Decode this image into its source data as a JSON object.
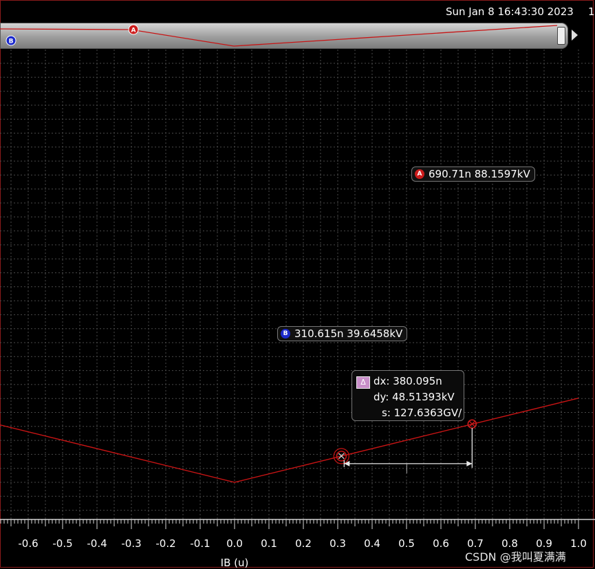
{
  "header": {
    "datetime": "Sun Jan 8 16:43:30 2023",
    "edge_char": "1"
  },
  "overview": {
    "marker_a_label": "A",
    "marker_b_label": "B"
  },
  "chart_data": {
    "type": "line",
    "xlabel": "IB (u)",
    "x_tick_labels": [
      "-0.6",
      "-0.5",
      "-0.4",
      "-0.3",
      "-0.2",
      "-0.1",
      "0.0",
      "0.1",
      "0.2",
      "0.3",
      "0.4",
      "0.5",
      "0.6",
      "0.7",
      "0.8",
      "0.9",
      "1.0"
    ],
    "x_ticks": [
      -0.6,
      -0.5,
      -0.4,
      -0.3,
      -0.2,
      -0.1,
      0.0,
      0.1,
      0.2,
      0.3,
      0.4,
      0.5,
      0.6,
      0.7,
      0.8,
      0.9,
      1.0
    ],
    "xlim": [
      -0.685,
      1.0
    ],
    "grid": true,
    "line_color": "#c81414",
    "series": [
      {
        "x": [
          -0.685,
          0.0,
          1.0
        ],
        "y": [
          87.1,
          0.0,
          127.2
        ]
      }
    ],
    "ylim_approx": [
      -16.0,
      158.0
    ]
  },
  "markers": {
    "a": {
      "badge": "A",
      "readout": "690.71n 88.1597kV",
      "x": 0.69071,
      "y": 88.1597,
      "color": "#cc1c1c"
    },
    "b": {
      "badge": "B",
      "readout": "310.615n 39.6458kV",
      "x": 0.310615,
      "y": 39.6458,
      "color": "#1c2acc"
    }
  },
  "delta": {
    "icon": "Δ",
    "dx": "dx: 380.095n",
    "dy": "dy: 48.51393kV",
    "s": "s: 127.6363GV/"
  },
  "watermark": "CSDN @我叫夏满满"
}
